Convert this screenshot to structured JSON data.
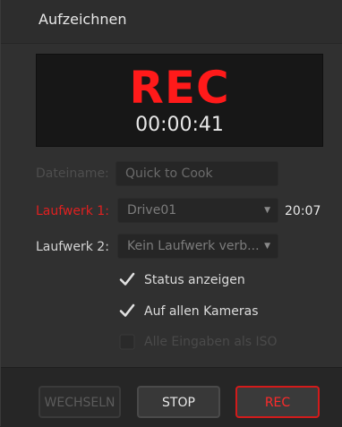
{
  "window": {
    "title": "Aufzeichnen"
  },
  "display": {
    "rec_label": "REC",
    "timecode": "00:00:41"
  },
  "filename": {
    "label": "Dateiname:",
    "value": "Quick to Cook"
  },
  "drive1": {
    "label": "Laufwerk 1:",
    "value": "Drive01",
    "remaining": "20:07",
    "label_color": "#e02020"
  },
  "drive2": {
    "label": "Laufwerk 2:",
    "value": "Kein Laufwerk verb..."
  },
  "options": [
    {
      "label": "Status anzeigen",
      "checked": true,
      "enabled": true
    },
    {
      "label": "Auf allen Kameras",
      "checked": true,
      "enabled": true
    },
    {
      "label": "Alle Eingaben als ISO",
      "checked": false,
      "enabled": false
    }
  ],
  "buttons": {
    "switch": "WECHSELN",
    "stop": "STOP",
    "rec": "REC"
  },
  "colors": {
    "rec_red": "#ff1a1a",
    "panel": "#303030"
  }
}
